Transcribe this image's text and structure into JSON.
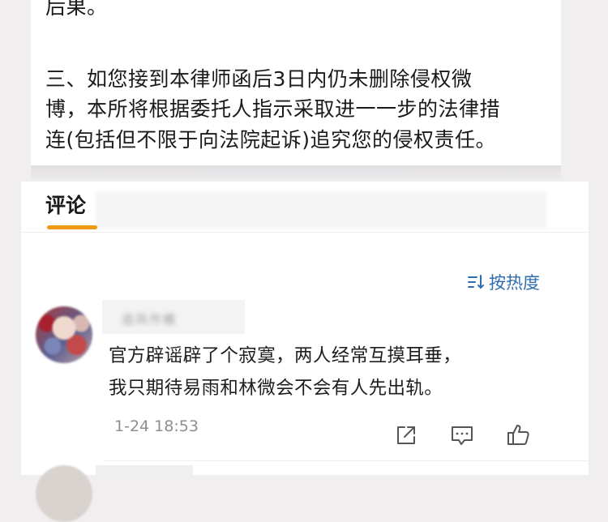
{
  "article": {
    "lines": [
      "后果。",
      "三、如您接到本律师函后3日内仍未删除侵权微",
      "博，本所将根据委托人指示采取进一一步的法律措",
      "连(包括但不限于向法院起诉)追究您的侵权责任。"
    ]
  },
  "comments": {
    "tab_label": "评论",
    "sort_label": "按热度",
    "items": [
      {
        "username": "追风作橘",
        "text_lines": [
          "官方辟谣辟了个寂寞，两人经常互摸耳垂，",
          "我只期待易雨和林微会不会有人先出轨。"
        ],
        "timestamp": "1-24 18:53"
      }
    ]
  },
  "icons": {
    "sort": "sort-icon",
    "share": "share-icon",
    "comment": "comment-icon",
    "like": "like-icon"
  },
  "colors": {
    "accent": "#f09a14",
    "link": "#2f6db1",
    "meta": "#8e8e8e"
  }
}
